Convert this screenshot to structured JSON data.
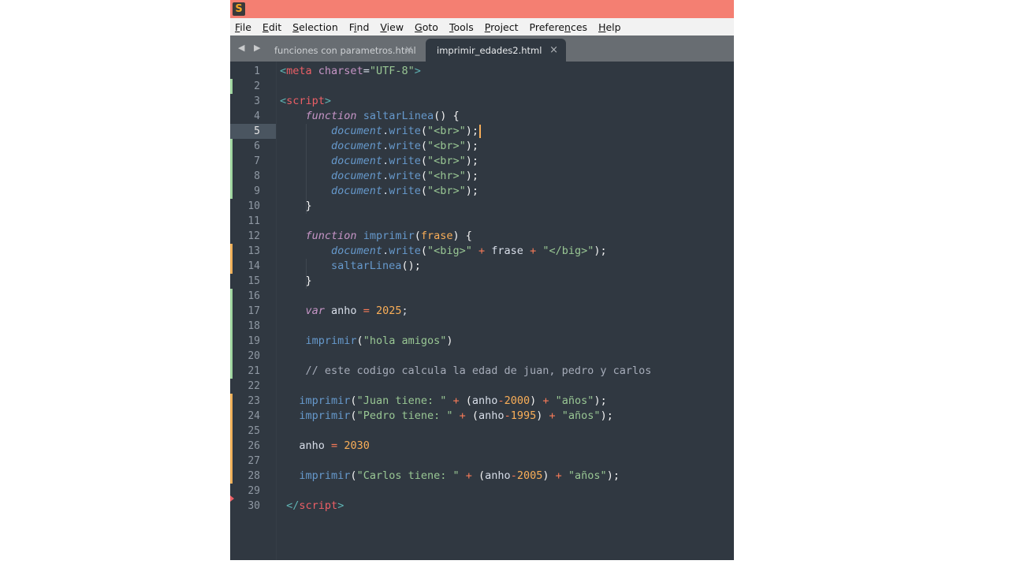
{
  "window": {
    "app_icon": "sublime-text-logo",
    "logo_glyph": "S",
    "titlebar_color": "#f47f72"
  },
  "menu": [
    {
      "label": "File",
      "underline": "F",
      "rest": "ile"
    },
    {
      "label": "Edit",
      "underline": "E",
      "rest": "dit"
    },
    {
      "label": "Selection",
      "underline": "S",
      "rest": "election"
    },
    {
      "label": "Find",
      "pre": "F",
      "underline": "i",
      "rest": "nd"
    },
    {
      "label": "View",
      "underline": "V",
      "rest": "iew"
    },
    {
      "label": "Goto",
      "underline": "G",
      "rest": "oto"
    },
    {
      "label": "Tools",
      "underline": "T",
      "rest": "ools"
    },
    {
      "label": "Project",
      "underline": "P",
      "rest": "roject"
    },
    {
      "label": "Preferences",
      "pre": "Prefere",
      "underline": "n",
      "rest": "ces"
    },
    {
      "label": "Help",
      "underline": "H",
      "rest": "elp"
    }
  ],
  "tabs": {
    "nav_glyphs": "◀ ▶",
    "items": [
      {
        "label": "funciones con parametros.html",
        "active": false,
        "close": "×"
      },
      {
        "label": "imprimir_edades2.html",
        "active": true,
        "close": "×"
      }
    ]
  },
  "editor": {
    "current_line": 5,
    "gutter_marks": {
      "added": [
        2,
        6,
        7,
        8,
        9,
        16,
        17,
        18,
        19,
        20,
        21
      ],
      "modified": [
        13,
        14,
        23,
        24,
        25,
        26,
        27,
        28
      ],
      "deleted_marker_after": 29
    },
    "lines": [
      {
        "n": 1,
        "tokens": [
          [
            "tag-punct",
            "<"
          ],
          [
            "tag",
            "meta"
          ],
          [
            "plain",
            " "
          ],
          [
            "attr",
            "charset"
          ],
          [
            "plain",
            "="
          ],
          [
            "str",
            "\"UTF-8\""
          ],
          [
            "tag-punct",
            ">"
          ]
        ]
      },
      {
        "n": 2,
        "tokens": []
      },
      {
        "n": 3,
        "tokens": [
          [
            "tag-punct",
            "<"
          ],
          [
            "tag",
            "script"
          ],
          [
            "tag-punct",
            ">"
          ]
        ]
      },
      {
        "n": 4,
        "tokens": [
          [
            "plain",
            "    "
          ],
          [
            "kw",
            "function"
          ],
          [
            "plain",
            " "
          ],
          [
            "fn",
            "saltarLinea"
          ],
          [
            "paren",
            "() {"
          ]
        ]
      },
      {
        "n": 5,
        "tokens": [
          [
            "plain",
            "        "
          ],
          [
            "obj",
            "document"
          ],
          [
            "plain",
            "."
          ],
          [
            "fn",
            "write"
          ],
          [
            "paren",
            "("
          ],
          [
            "str",
            "\"<br>\""
          ],
          [
            "paren",
            ");"
          ]
        ]
      },
      {
        "n": 6,
        "tokens": [
          [
            "plain",
            "        "
          ],
          [
            "obj",
            "document"
          ],
          [
            "plain",
            "."
          ],
          [
            "fn",
            "write"
          ],
          [
            "paren",
            "("
          ],
          [
            "str",
            "\"<br>\""
          ],
          [
            "paren",
            ");"
          ]
        ]
      },
      {
        "n": 7,
        "tokens": [
          [
            "plain",
            "        "
          ],
          [
            "obj",
            "document"
          ],
          [
            "plain",
            "."
          ],
          [
            "fn",
            "write"
          ],
          [
            "paren",
            "("
          ],
          [
            "str",
            "\"<br>\""
          ],
          [
            "paren",
            ");"
          ]
        ]
      },
      {
        "n": 8,
        "tokens": [
          [
            "plain",
            "        "
          ],
          [
            "obj",
            "document"
          ],
          [
            "plain",
            "."
          ],
          [
            "fn",
            "write"
          ],
          [
            "paren",
            "("
          ],
          [
            "str",
            "\"<hr>\""
          ],
          [
            "paren",
            ");"
          ]
        ]
      },
      {
        "n": 9,
        "tokens": [
          [
            "plain",
            "        "
          ],
          [
            "obj",
            "document"
          ],
          [
            "plain",
            "."
          ],
          [
            "fn",
            "write"
          ],
          [
            "paren",
            "("
          ],
          [
            "str",
            "\"<br>\""
          ],
          [
            "paren",
            ");"
          ]
        ]
      },
      {
        "n": 10,
        "tokens": [
          [
            "plain",
            "    "
          ],
          [
            "paren",
            "}"
          ]
        ]
      },
      {
        "n": 11,
        "tokens": []
      },
      {
        "n": 12,
        "tokens": [
          [
            "plain",
            "    "
          ],
          [
            "kw",
            "function"
          ],
          [
            "plain",
            " "
          ],
          [
            "fn",
            "imprimir"
          ],
          [
            "paren",
            "("
          ],
          [
            "param",
            "frase"
          ],
          [
            "paren",
            ") {"
          ]
        ]
      },
      {
        "n": 13,
        "tokens": [
          [
            "plain",
            "        "
          ],
          [
            "obj",
            "document"
          ],
          [
            "plain",
            "."
          ],
          [
            "fn",
            "write"
          ],
          [
            "paren",
            "("
          ],
          [
            "str",
            "\"<big>\""
          ],
          [
            "plain",
            " "
          ],
          [
            "op",
            "+"
          ],
          [
            "plain",
            " frase "
          ],
          [
            "op",
            "+"
          ],
          [
            "plain",
            " "
          ],
          [
            "str",
            "\"</big>\""
          ],
          [
            "paren",
            ");"
          ]
        ]
      },
      {
        "n": 14,
        "tokens": [
          [
            "plain",
            "        "
          ],
          [
            "fn",
            "saltarLinea"
          ],
          [
            "paren",
            "();"
          ]
        ]
      },
      {
        "n": 15,
        "tokens": [
          [
            "plain",
            "    "
          ],
          [
            "paren",
            "}"
          ]
        ]
      },
      {
        "n": 16,
        "tokens": []
      },
      {
        "n": 17,
        "tokens": [
          [
            "plain",
            "    "
          ],
          [
            "kw",
            "var"
          ],
          [
            "plain",
            " anho "
          ],
          [
            "op",
            "="
          ],
          [
            "plain",
            " "
          ],
          [
            "num",
            "2025"
          ],
          [
            "plain",
            ";"
          ]
        ]
      },
      {
        "n": 18,
        "tokens": []
      },
      {
        "n": 19,
        "tokens": [
          [
            "plain",
            "    "
          ],
          [
            "fn",
            "imprimir"
          ],
          [
            "paren",
            "("
          ],
          [
            "str",
            "\"hola amigos\""
          ],
          [
            "paren",
            ")"
          ]
        ]
      },
      {
        "n": 20,
        "tokens": []
      },
      {
        "n": 21,
        "tokens": [
          [
            "plain",
            "    "
          ],
          [
            "comment",
            "// este codigo calcula la edad de juan, pedro y carlos"
          ]
        ]
      },
      {
        "n": 22,
        "tokens": []
      },
      {
        "n": 23,
        "tokens": [
          [
            "plain",
            "   "
          ],
          [
            "fn",
            "imprimir"
          ],
          [
            "paren",
            "("
          ],
          [
            "str",
            "\"Juan tiene: \""
          ],
          [
            "plain",
            " "
          ],
          [
            "op",
            "+"
          ],
          [
            "plain",
            " "
          ],
          [
            "paren",
            "("
          ],
          [
            "plain",
            "anho"
          ],
          [
            "op",
            "-"
          ],
          [
            "num",
            "2000"
          ],
          [
            "paren",
            ")"
          ],
          [
            "plain",
            " "
          ],
          [
            "op",
            "+"
          ],
          [
            "plain",
            " "
          ],
          [
            "str",
            "\"años\""
          ],
          [
            "paren",
            ");"
          ]
        ]
      },
      {
        "n": 24,
        "tokens": [
          [
            "plain",
            "   "
          ],
          [
            "fn",
            "imprimir"
          ],
          [
            "paren",
            "("
          ],
          [
            "str",
            "\"Pedro tiene: \""
          ],
          [
            "plain",
            " "
          ],
          [
            "op",
            "+"
          ],
          [
            "plain",
            " "
          ],
          [
            "paren",
            "("
          ],
          [
            "plain",
            "anho"
          ],
          [
            "op",
            "-"
          ],
          [
            "num",
            "1995"
          ],
          [
            "paren",
            ")"
          ],
          [
            "plain",
            " "
          ],
          [
            "op",
            "+"
          ],
          [
            "plain",
            " "
          ],
          [
            "str",
            "\"años\""
          ],
          [
            "paren",
            ");"
          ]
        ]
      },
      {
        "n": 25,
        "tokens": []
      },
      {
        "n": 26,
        "tokens": [
          [
            "plain",
            "   anho "
          ],
          [
            "op",
            "="
          ],
          [
            "plain",
            " "
          ],
          [
            "num",
            "2030"
          ]
        ]
      },
      {
        "n": 27,
        "tokens": []
      },
      {
        "n": 28,
        "tokens": [
          [
            "plain",
            "   "
          ],
          [
            "fn",
            "imprimir"
          ],
          [
            "paren",
            "("
          ],
          [
            "str",
            "\"Carlos tiene: \""
          ],
          [
            "plain",
            " "
          ],
          [
            "op",
            "+"
          ],
          [
            "plain",
            " "
          ],
          [
            "paren",
            "("
          ],
          [
            "plain",
            "anho"
          ],
          [
            "op",
            "-"
          ],
          [
            "num",
            "2005"
          ],
          [
            "paren",
            ")"
          ],
          [
            "plain",
            " "
          ],
          [
            "op",
            "+"
          ],
          [
            "plain",
            " "
          ],
          [
            "str",
            "\"años\""
          ],
          [
            "paren",
            ");"
          ]
        ]
      },
      {
        "n": 29,
        "tokens": []
      },
      {
        "n": 30,
        "tokens": [
          [
            "plain",
            " "
          ],
          [
            "tag-punct",
            "</"
          ],
          [
            "tag",
            "script"
          ],
          [
            "tag-punct",
            ">"
          ]
        ]
      }
    ]
  }
}
